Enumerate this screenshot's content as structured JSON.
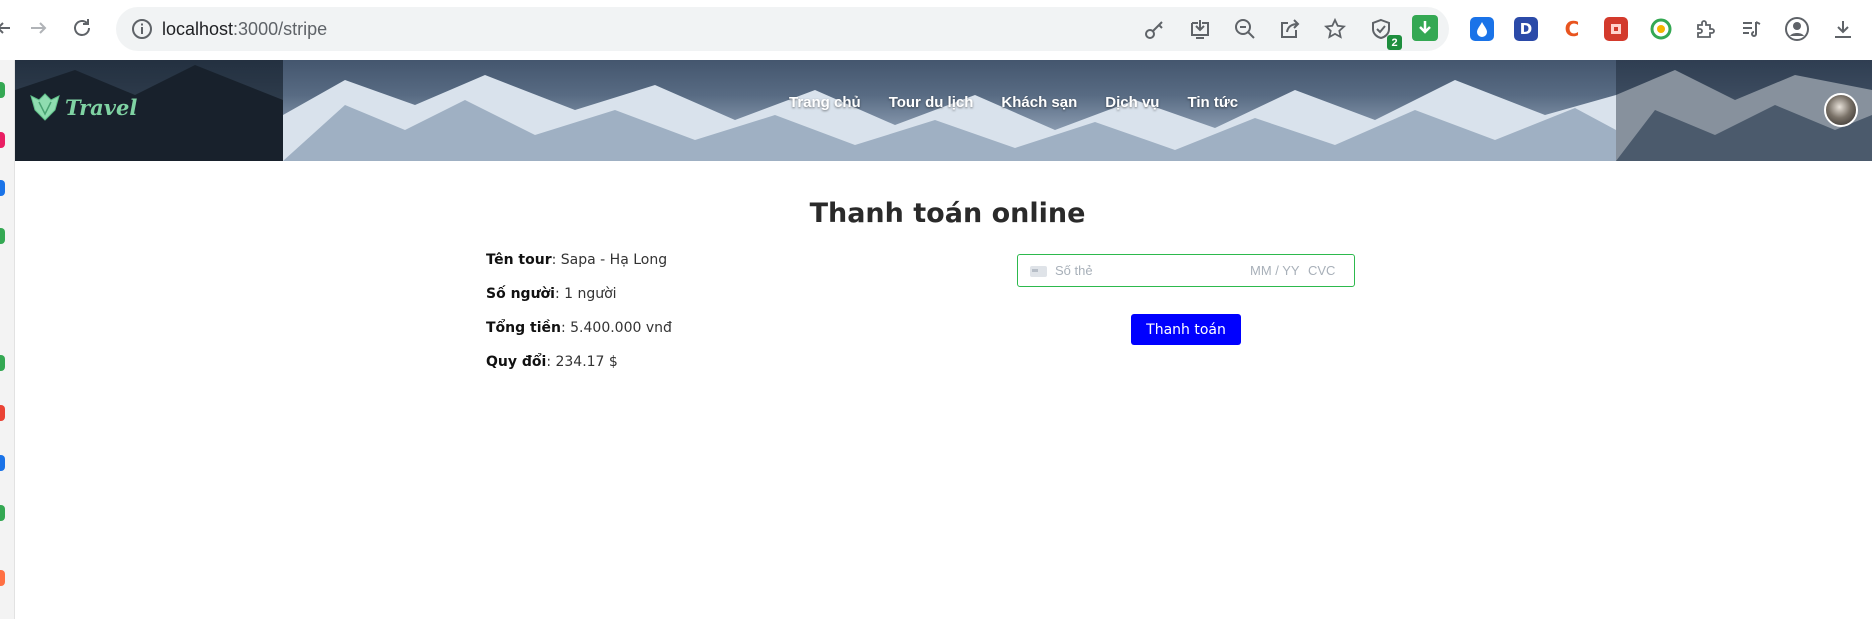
{
  "browser": {
    "url_host": "localhost",
    "url_path": ":3000/stripe",
    "extensions": [
      {
        "name": "drop-extension-icon",
        "glyph": "",
        "color": "#1a73e8"
      },
      {
        "name": "d-extension-icon",
        "glyph": "D",
        "color": "#2b4aa8"
      },
      {
        "name": "c-extension-icon",
        "glyph": "C",
        "color": "#e8541f"
      },
      {
        "name": "red-extension-icon",
        "glyph": "",
        "color": "#d33a2c"
      },
      {
        "name": "circle-extension-icon",
        "glyph": "",
        "color": "#34a853"
      }
    ],
    "shield_badge": "2"
  },
  "site": {
    "logo_text": "Travel",
    "menu": [
      "Trang chủ",
      "Tour du lịch",
      "Khách sạn",
      "Dịch vụ",
      "Tin tức"
    ]
  },
  "page": {
    "title": "Thanh toán online",
    "info": [
      {
        "label": "Tên tour",
        "value": ": Sapa - Hạ Long"
      },
      {
        "label": "Số người",
        "value": ":  1 người"
      },
      {
        "label": "Tổng tiền",
        "value": ": 5.400.000 vnđ"
      },
      {
        "label": "Quy đổi",
        "value": ": 234.17 $"
      }
    ],
    "card": {
      "number_placeholder": "Số thẻ",
      "expiry_placeholder": "MM / YY",
      "cvc_placeholder": "CVC"
    },
    "pay_button": "Thanh toán"
  },
  "colors": {
    "accent_button": "#0000ff",
    "focus_border": "#2db94d",
    "logo": "#7fd3a3"
  }
}
